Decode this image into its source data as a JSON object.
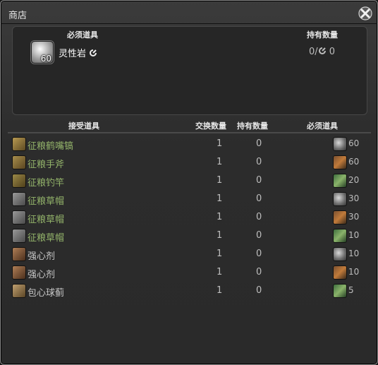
{
  "window": {
    "title": "商店"
  },
  "required_section": {
    "header_required": "必须道具",
    "header_held": "持有数量",
    "item": {
      "name": "灵性岩",
      "qty": "60",
      "held": "0/",
      "held_suffix": "0"
    }
  },
  "columns": {
    "received": "接受道具",
    "exchange_qty": "交换数量",
    "held_qty": "持有数量",
    "required": "必须道具"
  },
  "rows": [
    {
      "name": "征粮鹤嘴镐",
      "exchange": "1",
      "held": "0",
      "required": "60",
      "name_color": "#93b36a",
      "icon": "pickaxe-icon",
      "req_icon": "stone-icon"
    },
    {
      "name": "征粮手斧",
      "exchange": "1",
      "held": "0",
      "required": "60",
      "name_color": "#93b36a",
      "icon": "hatchet-icon",
      "req_icon": "stone-icon"
    },
    {
      "name": "征粮钓竿",
      "exchange": "1",
      "held": "0",
      "required": "20",
      "name_color": "#93b36a",
      "icon": "fishing-rod-icon",
      "req_icon": "stone-icon"
    },
    {
      "name": "征粮草帽",
      "exchange": "1",
      "held": "0",
      "required": "30",
      "name_color": "#93b36a",
      "icon": "hat-icon",
      "req_icon": "stone-icon"
    },
    {
      "name": "征粮草帽",
      "exchange": "1",
      "held": "0",
      "required": "30",
      "name_color": "#93b36a",
      "icon": "hat-icon",
      "req_icon": "stone-icon"
    },
    {
      "name": "征粮草帽",
      "exchange": "1",
      "held": "0",
      "required": "10",
      "name_color": "#93b36a",
      "icon": "hat-icon",
      "req_icon": "stone-icon"
    },
    {
      "name": "强心剂",
      "exchange": "1",
      "held": "0",
      "required": "10",
      "name_color": "#c8c8c8",
      "icon": "potion-icon",
      "req_icon": "stone-icon"
    },
    {
      "name": "强心剂",
      "exchange": "1",
      "held": "0",
      "required": "10",
      "name_color": "#c8c8c8",
      "icon": "potion-icon",
      "req_icon": "stone-icon"
    },
    {
      "name": "包心球蓟",
      "exchange": "1",
      "held": "0",
      "required": "5",
      "name_color": "#c8c8c8",
      "icon": "fork-knife-icon",
      "req_icon": "stone-icon"
    }
  ]
}
